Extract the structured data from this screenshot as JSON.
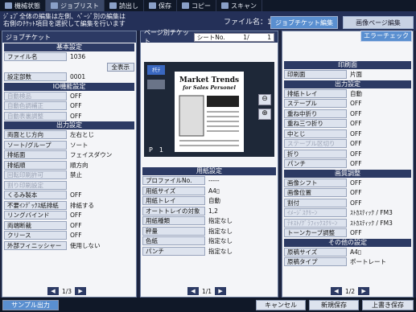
{
  "topbar": {
    "tabs": [
      {
        "label": "機械状態",
        "icon": "machine-status-icon"
      },
      {
        "label": "ジョブリスト",
        "icon": "job-list-icon"
      },
      {
        "label": "読出し",
        "icon": "read-icon"
      },
      {
        "label": "保存",
        "icon": "save-icon"
      },
      {
        "label": "コピー",
        "icon": "copy-icon"
      },
      {
        "label": "スキャン",
        "icon": "scan-icon"
      }
    ]
  },
  "header": {
    "message_line1": "ｼﾞｮﾌﾞ全体の編集は左側、ﾍﾟｰｼﾞ別の編集は",
    "message_line2": "右側のﾁｹｯﾄ項目を選択して編集を行います",
    "file_name": "ファイル名：1036",
    "tab_job_ticket": "ジョブチケット編集",
    "tab_image_page": "画像ページ編集"
  },
  "left": {
    "title": "ジョブチケット",
    "basic_section": "基本設定",
    "file_name_label": "ファイル名",
    "file_name_value": "1036",
    "show_all": "全表示",
    "dept_label": "設定部数",
    "dept_value": "0001",
    "io_section": "IO機能設定",
    "io_rows": [
      {
        "label": "自動検品",
        "value": "OFF"
      },
      {
        "label": "自動色調補正",
        "value": "OFF"
      },
      {
        "label": "自動表裏調整",
        "value": "OFF"
      }
    ],
    "output_section": "出力設定",
    "output_rows": [
      {
        "label": "両面とじ方向",
        "value": "左右とじ"
      },
      {
        "label": "ソート/グループ",
        "value": "ソート"
      },
      {
        "label": "排紙面",
        "value": "フェイスダウン"
      },
      {
        "label": "排紙順",
        "value": "順方向"
      },
      {
        "label": "回転印刷許可",
        "value": "禁止"
      },
      {
        "label": "割り印刷設定",
        "value": ""
      },
      {
        "label": "くるみ製本",
        "value": "OFF"
      },
      {
        "label": "不要ｲﾝﾃﾞｯｸｽ紙排紙",
        "value": "排紙する"
      },
      {
        "label": "リングバインド",
        "value": "OFF"
      },
      {
        "label": "両端断裁",
        "value": "OFF"
      },
      {
        "label": "クリース",
        "value": "OFF"
      },
      {
        "label": "外部フィニッシャー",
        "value": "使用しない"
      }
    ],
    "page": "1/3"
  },
  "middle": {
    "title": "ページ別チケット",
    "sheet_label": "シートNo.",
    "sheet_value": "1/",
    "sheet_total": "1",
    "preview_label": "ｵﾓﾃ",
    "preview_page": "P　1",
    "doc_title1": "Market Trends",
    "doc_title2": "for Sales Personel",
    "paper_section": "用紙設定",
    "paper_rows": [
      {
        "label": "プロファイルNo.",
        "value": "-----"
      },
      {
        "label": "用紙サイズ",
        "value": "A4▯"
      },
      {
        "label": "用紙トレイ",
        "value": "自動"
      },
      {
        "label": "オートトレイの対象",
        "value": "1,2"
      },
      {
        "label": "用紙種類",
        "value": "指定なし"
      },
      {
        "label": "秤量",
        "value": "指定なし"
      },
      {
        "label": "色紙",
        "value": "指定なし"
      },
      {
        "label": "パンチ",
        "value": "指定なし"
      }
    ],
    "page": "1/1"
  },
  "right": {
    "error_check": "エラーチェック",
    "print_section": "印刷面",
    "print_label": "印刷面",
    "print_value": "片面",
    "output_section": "出力設定",
    "output_rows": [
      {
        "label": "排紙トレイ",
        "value": "自動"
      },
      {
        "label": "ステープル",
        "value": "OFF"
      },
      {
        "label": "重ね中折り",
        "value": "OFF"
      },
      {
        "label": "重ね三つ折り",
        "value": "OFF"
      },
      {
        "label": "中とじ",
        "value": "OFF"
      },
      {
        "label": "ステープル区切り",
        "value": "OFF"
      },
      {
        "label": "折り",
        "value": "OFF"
      },
      {
        "label": "パンチ",
        "value": "OFF"
      }
    ],
    "image_section": "画質調整",
    "image_rows": [
      {
        "label": "画像シフト",
        "value": "OFF"
      },
      {
        "label": "画像位置",
        "value": "OFF"
      },
      {
        "label": "割付",
        "value": "OFF"
      },
      {
        "label": "ｲﾒｰｼﾞｽｸﾘｰﾝ",
        "value": "ｽﾄｶｽﾃｨｯｸ / FM3"
      },
      {
        "label": "ﾃｷｽﾄ/ｸﾞﾗﾌｨｯｸｽｸﾘｰﾝ",
        "value": "ｽﾄｶｽﾃｨｯｸ / FM3"
      },
      {
        "label": "トーンカーブ調整",
        "value": "OFF"
      }
    ],
    "other_section": "その他の設定",
    "other_rows": [
      {
        "label": "原稿サイズ",
        "value": "A4▯"
      },
      {
        "label": "原稿タイプ",
        "value": "ポートレート"
      }
    ],
    "page": "1/2"
  },
  "footer": {
    "sample_output": "サンプル出力",
    "cancel": "キャンセル",
    "new_save": "新規保存",
    "overwrite_save": "上書き保存"
  }
}
